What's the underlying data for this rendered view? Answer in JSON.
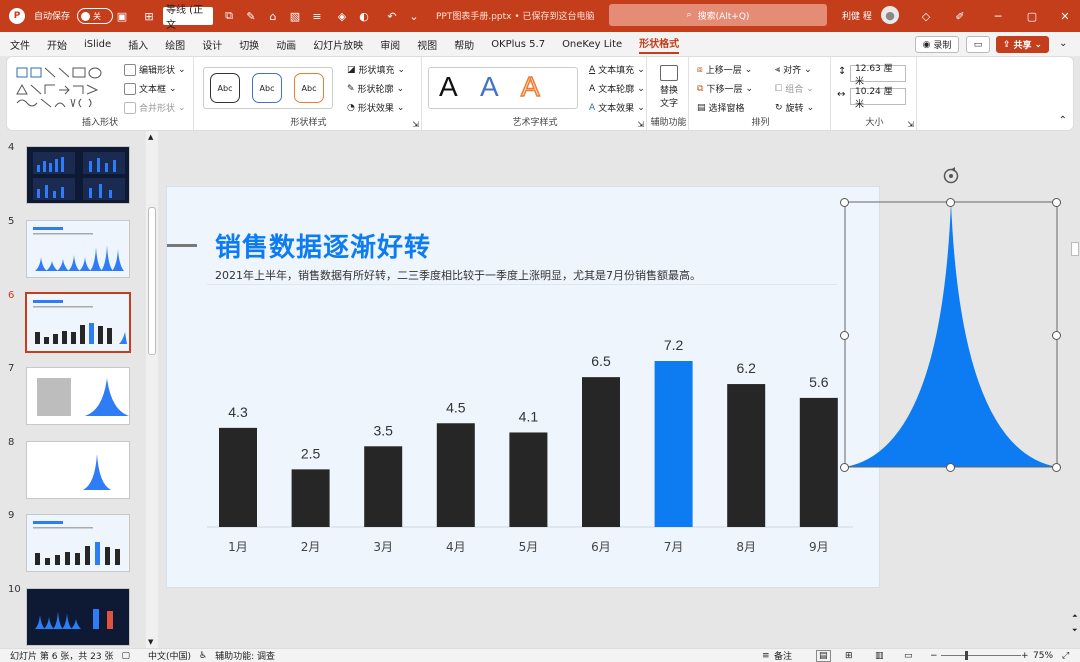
{
  "titlebar": {
    "autosave_label": "自动保存",
    "autosave_state": "关",
    "font_name": "等线 (正文",
    "file_title": "PPT图表手册.pptx • 已保存到这台电脑",
    "search_placeholder": "搜索(Alt+Q)",
    "user_name": "利健 程"
  },
  "menu": {
    "tabs": [
      "文件",
      "开始",
      "iSlide",
      "插入",
      "绘图",
      "设计",
      "切换",
      "动画",
      "幻灯片放映",
      "审阅",
      "视图",
      "帮助",
      "OKPlus 5.7",
      "OneKey Lite",
      "形状格式"
    ],
    "active_tab": "形状格式",
    "record_label": "录制",
    "share_label": "共享"
  },
  "ribbon": {
    "insert_shape": {
      "label": "插入形状",
      "edit_shape": "编辑形状",
      "text_box": "文本框",
      "merge_shapes": "合并形状"
    },
    "shape_styles": {
      "label": "形状样式",
      "presets": [
        "Abc",
        "Abc",
        "Abc"
      ],
      "fill": "形状填充",
      "outline": "形状轮廓",
      "effects": "形状效果"
    },
    "wordart": {
      "label": "艺术字样式",
      "sample": "A",
      "text_fill": "文本填充",
      "text_outline": "文本轮廓",
      "text_effects": "文本效果"
    },
    "accessibility": {
      "label": "辅助功能",
      "alt_text_line1": "替换",
      "alt_text_line2": "文字"
    },
    "arrange": {
      "label": "排列",
      "bring_forward": "上移一层",
      "send_backward": "下移一层",
      "selection_pane": "选择窗格",
      "align": "对齐",
      "group": "组合",
      "rotate": "旋转"
    },
    "size": {
      "label": "大小",
      "height": "12.63 厘米",
      "width": "10.24 厘米"
    }
  },
  "thumbnails": [
    {
      "num": "4"
    },
    {
      "num": "5"
    },
    {
      "num": "6"
    },
    {
      "num": "7"
    },
    {
      "num": "8"
    },
    {
      "num": "9"
    },
    {
      "num": "10"
    }
  ],
  "slide": {
    "title": "销售数据逐渐好转",
    "subtitle": "2021年上半年，销售数据有所好转，二三季度相比较于一季度上涨明显，尤其是7月份销售额最高。"
  },
  "colors": {
    "accent": "#c43e1c",
    "bar": "#262626",
    "highlight": "#0d7cf2",
    "title": "#0d7cf2"
  },
  "chart_data": {
    "type": "bar",
    "categories": [
      "1月",
      "2月",
      "3月",
      "4月",
      "5月",
      "6月",
      "7月",
      "8月",
      "9月"
    ],
    "values": [
      4.3,
      2.5,
      3.5,
      4.5,
      4.1,
      6.5,
      7.2,
      6.2,
      5.6
    ],
    "value_labels": [
      "4.3",
      "2.5",
      "3.5",
      "4.5",
      "4.1",
      "6.5",
      "7.2",
      "6.2",
      "5.6"
    ],
    "highlight_index": 6,
    "ylim": [
      0,
      7.2
    ],
    "title": "",
    "xlabel": "",
    "ylabel": ""
  },
  "status": {
    "slide_info": "幻灯片 第 6 张，共 23 张",
    "language": "中文(中国)",
    "accessibility": "辅助功能: 调查",
    "notes": "备注",
    "zoom": "75%"
  }
}
